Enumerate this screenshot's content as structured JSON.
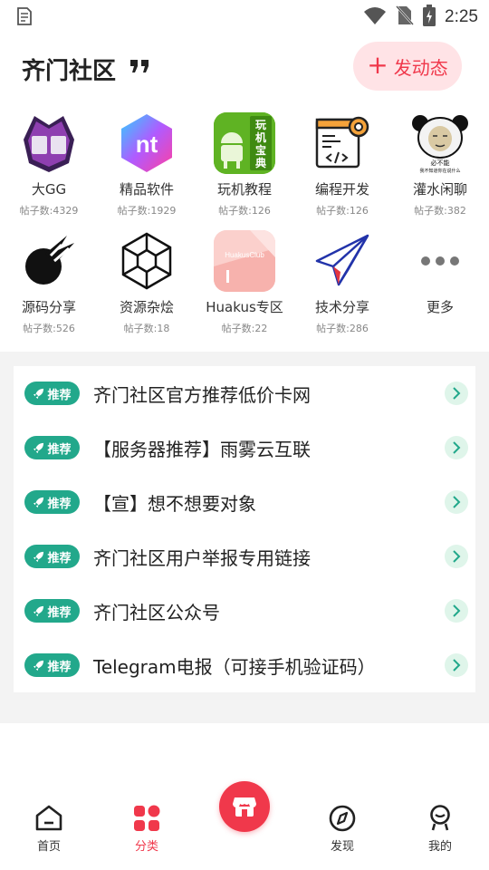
{
  "status_bar": {
    "time": "2:25"
  },
  "header": {
    "title": "齐门社区",
    "post_button_label": "发动态"
  },
  "categories": [
    {
      "name": "大GG",
      "count": "帖子数:4329"
    },
    {
      "name": "精品软件",
      "count": "帖子数:1929"
    },
    {
      "name": "玩机教程",
      "count": "帖子数:126"
    },
    {
      "name": "编程开发",
      "count": "帖子数:126"
    },
    {
      "name": "灌水闲聊",
      "count": "帖子数:382"
    },
    {
      "name": "源码分享",
      "count": "帖子数:526"
    },
    {
      "name": "资源杂烩",
      "count": "帖子数:18"
    },
    {
      "name": "Huakus专区",
      "count": "帖子数:22"
    },
    {
      "name": "技术分享",
      "count": "帖子数:286"
    },
    {
      "name": "更多",
      "count": ""
    }
  ],
  "icon_text": {
    "gg": "G",
    "nt": "nt",
    "guide": [
      "玩",
      "机",
      "宝",
      "典"
    ],
    "meme": [
      "必不能",
      "我不知道你在说什么"
    ],
    "huakus": "HuakusClub"
  },
  "recommend": {
    "tag_label": "推荐",
    "items": [
      {
        "title": "齐门社区官方推荐低价卡网"
      },
      {
        "title": "【服务器推荐】雨雾云互联"
      },
      {
        "title": "【宣】想不想要对象"
      },
      {
        "title": "齐门社区用户举报专用链接"
      },
      {
        "title": "齐门社区公众号"
      },
      {
        "title": "Telegram电报（可接手机验证码）"
      }
    ]
  },
  "bottom_nav": [
    {
      "label": "首页",
      "icon": "home-icon"
    },
    {
      "label": "分类",
      "icon": "category-icon",
      "active": true
    },
    {
      "label": "",
      "icon": "store-icon"
    },
    {
      "label": "发现",
      "icon": "compass-icon"
    },
    {
      "label": "我的",
      "icon": "profile-icon"
    }
  ],
  "colors": {
    "accent": "#f0384b",
    "tag_green": "#22a88b",
    "post_button_bg": "#ffe3e6"
  }
}
